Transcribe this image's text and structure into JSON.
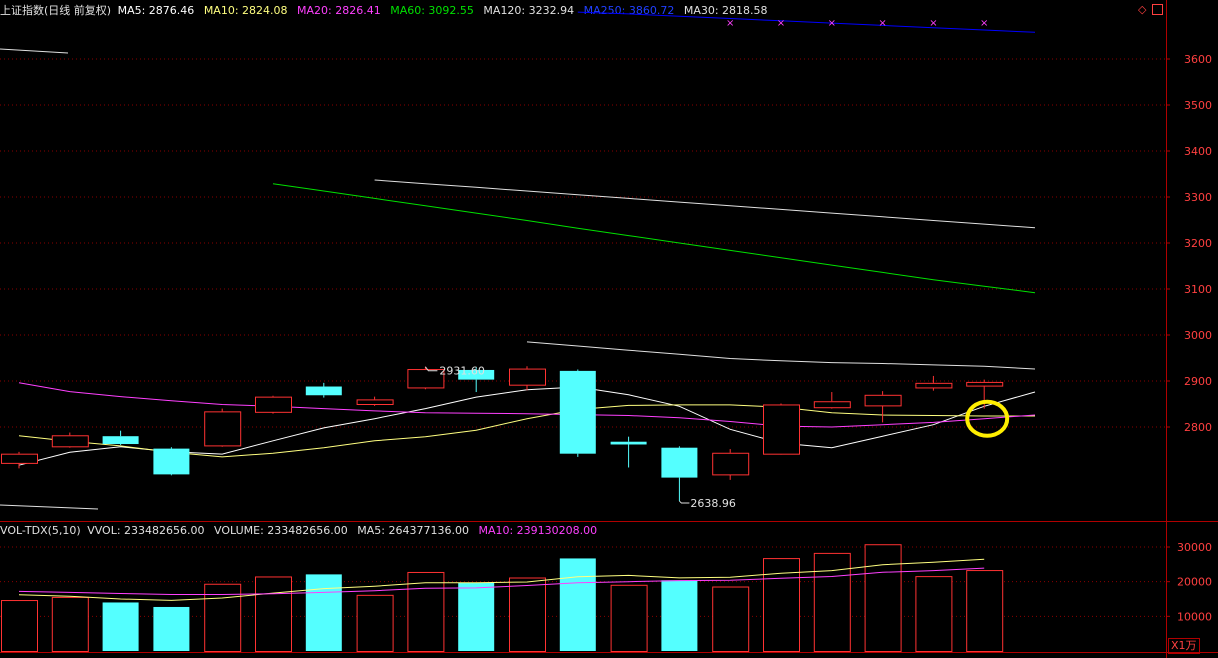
{
  "header": {
    "title": "上证指数(日线 前复权)",
    "ma5": "MA5: 2876.46",
    "ma10": "MA10: 2824.08",
    "ma20": "MA20: 2826.41",
    "ma60": "MA60: 3092.55",
    "ma120": "MA120: 3232.94",
    "ma250": "MA250: 3860.72",
    "ma30": "MA30: 2818.58"
  },
  "vol_header": {
    "title": "VOL-TDX(5,10)",
    "vvol": "VVOL: 233482656.00",
    "volume": "VOLUME: 233482656.00",
    "ma5": "MA5: 264377136.00",
    "ma10": "MA10: 239130208.00"
  },
  "unit_label": "X1万",
  "colors": {
    "up": "#ff3232",
    "down": "#54ffff",
    "ma5": "#ffffff",
    "ma10": "#ffff80",
    "ma20": "#ff40ff",
    "ma60": "#00e000",
    "ma120": "#e0e0e0",
    "ma250": "#0000ff",
    "axis": "#b00000",
    "grid": "#8a0000",
    "highlight": "#ffee00"
  },
  "chart_data": [
    {
      "type": "candlestick",
      "y_ticks": [
        2800,
        2900,
        3000,
        3100,
        3200,
        3300,
        3400,
        3500,
        3600
      ],
      "ylim": [
        2618,
        3720
      ],
      "candles": [
        {
          "o": 2722,
          "c": 2742,
          "h": 2746,
          "l": 2710
        },
        {
          "o": 2758,
          "c": 2782,
          "h": 2788,
          "l": 2755
        },
        {
          "o": 2780,
          "c": 2763,
          "h": 2792,
          "l": 2761
        },
        {
          "o": 2753,
          "c": 2697,
          "h": 2756,
          "l": 2695
        },
        {
          "o": 2760,
          "c": 2834,
          "h": 2840,
          "l": 2757
        },
        {
          "o": 2833,
          "c": 2866,
          "h": 2868,
          "l": 2829
        },
        {
          "o": 2888,
          "c": 2869,
          "h": 2896,
          "l": 2864
        },
        {
          "o": 2850,
          "c": 2860,
          "h": 2866,
          "l": 2846
        },
        {
          "o": 2886,
          "c": 2926,
          "h": 2931,
          "l": 2882
        },
        {
          "o": 2924,
          "c": 2903,
          "h": 2930,
          "l": 2876
        },
        {
          "o": 2892,
          "c": 2927,
          "h": 2932,
          "l": 2880
        },
        {
          "o": 2922,
          "c": 2742,
          "h": 2925,
          "l": 2735
        },
        {
          "o": 2768,
          "c": 2762,
          "h": 2779,
          "l": 2712
        },
        {
          "o": 2755,
          "c": 2690,
          "h": 2758,
          "l": 2639
        },
        {
          "o": 2697,
          "c": 2744,
          "h": 2752,
          "l": 2685
        },
        {
          "o": 2742,
          "c": 2849,
          "h": 2851,
          "l": 2740
        },
        {
          "o": 2843,
          "c": 2856,
          "h": 2876,
          "l": 2840
        },
        {
          "o": 2847,
          "c": 2870,
          "h": 2878,
          "l": 2810
        },
        {
          "o": 2886,
          "c": 2896,
          "h": 2911,
          "l": 2879
        },
        {
          "o": 2890,
          "c": 2898,
          "h": 2903,
          "l": 2840
        }
      ],
      "series": [
        {
          "name": "MA5",
          "values": [
            2717,
            2745,
            2757,
            2746,
            2741,
            2770,
            2798,
            2818,
            2840,
            2865,
            2881,
            2887,
            2870,
            2845,
            2795,
            2765,
            2755,
            2780,
            2805,
            2845,
            2876
          ]
        },
        {
          "name": "MA10",
          "values": [
            2781,
            2769,
            2759,
            2745,
            2735,
            2743,
            2755,
            2770,
            2779,
            2793,
            2818,
            2838,
            2847,
            2848,
            2848,
            2843,
            2831,
            2826,
            2825,
            2824,
            2824
          ]
        },
        {
          "name": "MA20",
          "values": [
            2896,
            2877,
            2866,
            2857,
            2849,
            2845,
            2840,
            2835,
            2831,
            2830,
            2829,
            2827,
            2825,
            2820,
            2812,
            2802,
            2800,
            2805,
            2810,
            2818,
            2826
          ]
        },
        {
          "name": "MA30",
          "values": [
            2985,
            2976,
            2967,
            2958,
            2949,
            2944,
            2940,
            2938,
            2935,
            2932,
            2926
          ]
        },
        {
          "name": "MA60",
          "values": [
            3329,
            3313,
            3297,
            3281,
            3265,
            3249,
            3232,
            3216,
            3200,
            3184,
            3168,
            3152,
            3136,
            3120,
            3106,
            3092
          ]
        },
        {
          "name": "MA120",
          "values": [
            3337,
            3329,
            3321,
            3313,
            3305,
            3297,
            3289,
            3281,
            3273,
            3265,
            3257,
            3249,
            3241,
            3233
          ]
        },
        {
          "name": "MA250",
          "values": [
            3702,
            3698,
            3693,
            3688,
            3683,
            3678,
            3673,
            3668,
            3663,
            3658
          ]
        }
      ],
      "annotations": [
        {
          "text": "2638.96",
          "candle": 13,
          "value": 2639
        },
        {
          "text": "2931.60",
          "candle": 8,
          "value": 2931
        }
      ],
      "markers": {
        "symbol": "×",
        "candles": [
          14,
          15,
          16,
          17,
          18,
          19
        ]
      }
    },
    {
      "type": "bar",
      "y_ticks": [
        10000,
        20000,
        30000
      ],
      "ylim": [
        0,
        31000
      ],
      "values": [
        14700,
        15600,
        14000,
        12700,
        19400,
        21500,
        22100,
        16200,
        22800,
        19700,
        21200,
        26700,
        19100,
        20400,
        18600,
        26800,
        28300,
        30800,
        21600,
        23348
      ],
      "up": [
        true,
        true,
        false,
        false,
        true,
        true,
        false,
        true,
        true,
        false,
        true,
        false,
        true,
        false,
        true,
        true,
        true,
        true,
        true,
        true
      ],
      "series": [
        {
          "name": "MA5",
          "values": [
            16200,
            15800,
            15000,
            14600,
            15300,
            16700,
            18000,
            18700,
            19700,
            19700,
            19900,
            21400,
            21800,
            21100,
            21300,
            22400,
            23200,
            24900,
            25600,
            26438
          ]
        },
        {
          "name": "MA10",
          "values": [
            17200,
            16900,
            16600,
            16300,
            16300,
            16500,
            16900,
            17400,
            18100,
            18200,
            18900,
            19700,
            20000,
            20300,
            20400,
            21000,
            21500,
            22700,
            23200,
            23913
          ]
        }
      ]
    }
  ]
}
